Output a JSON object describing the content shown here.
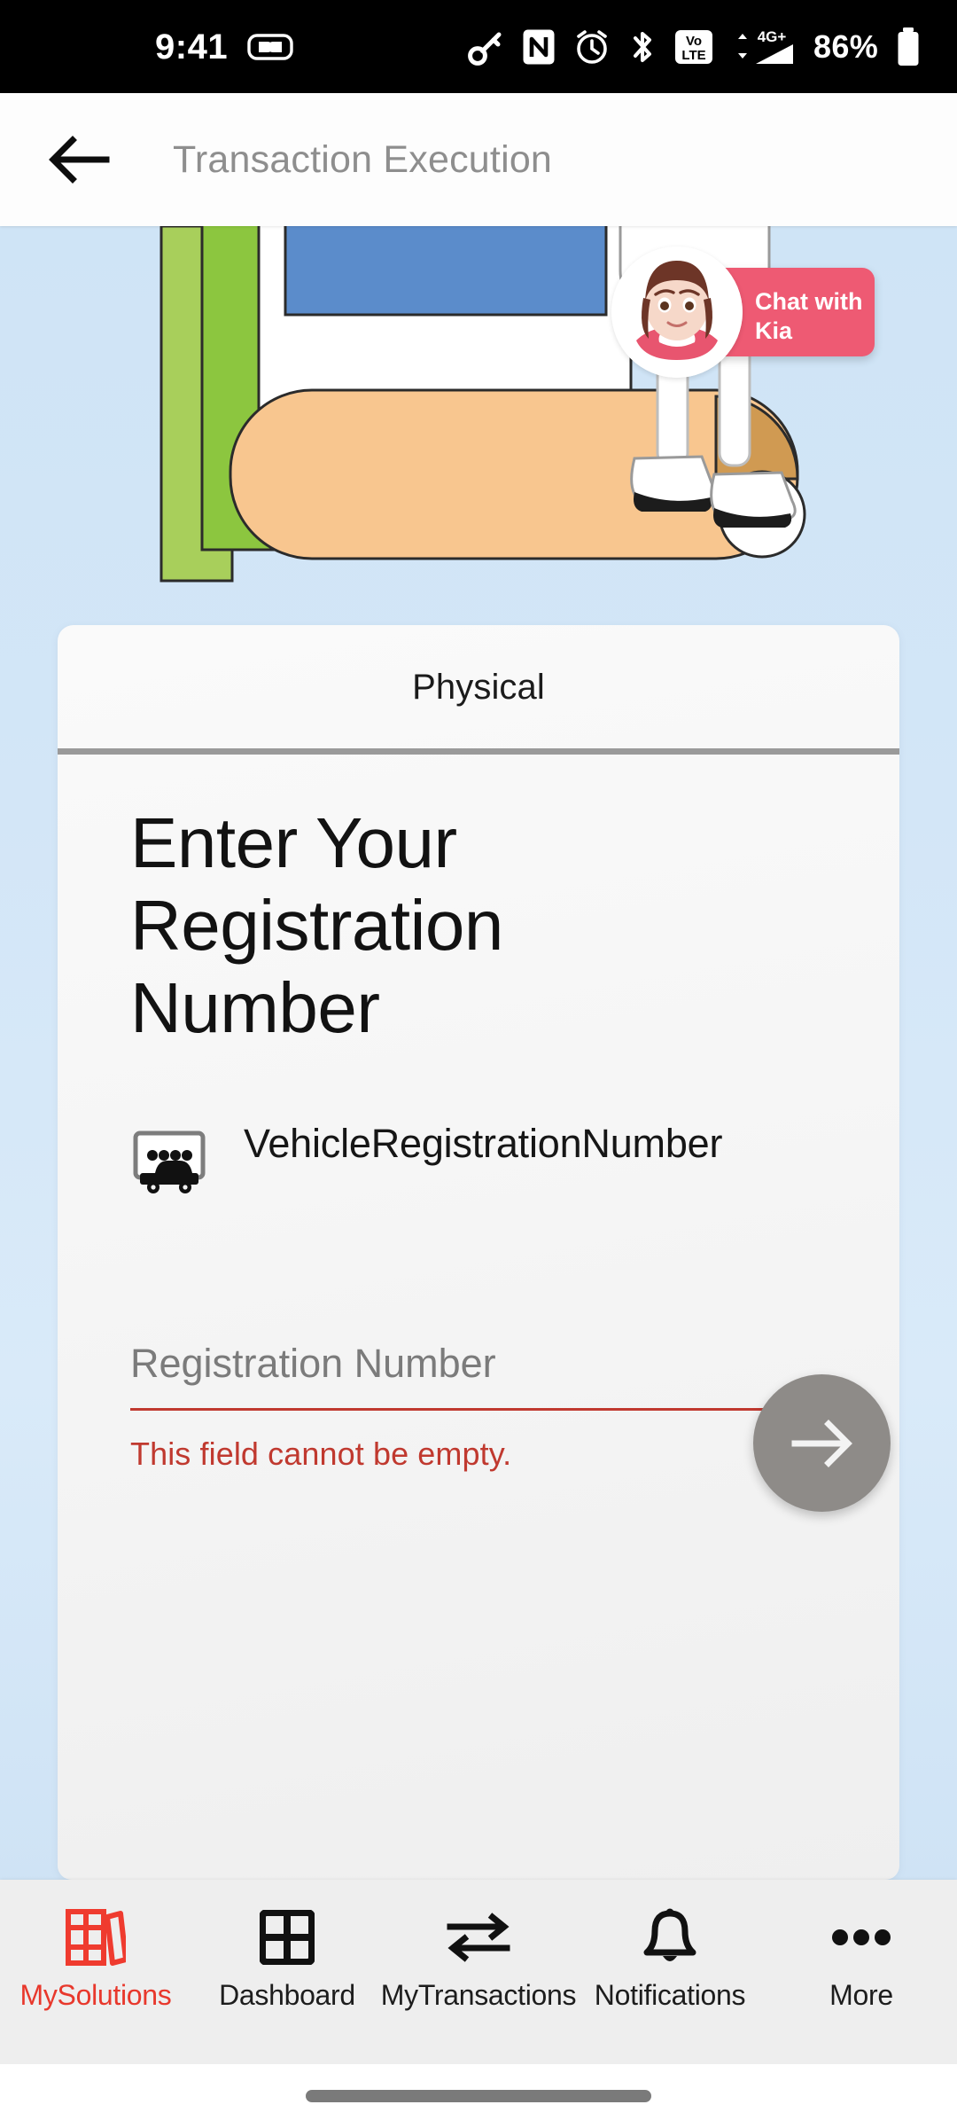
{
  "status_bar": {
    "time": "9:41",
    "battery_percent": "86%",
    "left_icons": [
      "earbuds-icon"
    ],
    "right_icons": [
      "vpn-key-icon",
      "nfc-icon",
      "alarm-icon",
      "bluetooth-icon",
      "volte-icon",
      "signal-4g-plus-icon",
      "battery-icon"
    ],
    "network_label": "VoLTE",
    "data_label": "4G+"
  },
  "app_bar": {
    "back_icon": "arrow-left-icon",
    "title": "Transaction Execution"
  },
  "hero": {
    "chat_widget": {
      "line1": "Chat with",
      "line2": "Kia",
      "avatar": "kia-avatar",
      "background_color": "#ee5a73"
    }
  },
  "card": {
    "tab": {
      "label": "Physical",
      "active": true
    },
    "headline": "Enter Your Registration Number",
    "field": {
      "icon": "vehicle-registration-plate-icon",
      "label": "VehicleRegistrationNumber",
      "placeholder": "Registration Number",
      "value": "",
      "error": "This field cannot be empty.",
      "error_color": "#c0392f"
    },
    "next_button": {
      "icon": "arrow-right-icon",
      "color": "#8e8b88"
    }
  },
  "bottom_nav": {
    "active_color": "#e8382c",
    "items": [
      {
        "label": "MySolutions",
        "icon": "books-icon",
        "active": true
      },
      {
        "label": "Dashboard",
        "icon": "grid-icon",
        "active": false
      },
      {
        "label": "MyTransactions",
        "icon": "swap-arrows-icon",
        "active": false
      },
      {
        "label": "Notifications",
        "icon": "bell-icon",
        "active": false
      },
      {
        "label": "More",
        "icon": "ellipsis-icon",
        "active": false
      }
    ]
  },
  "theme": {
    "background_gradient_top": "#cfe4f6",
    "background_gradient_bottom": "#cfe3f5",
    "card_background": "#f7f7f7",
    "accent_red": "#e8382c"
  }
}
